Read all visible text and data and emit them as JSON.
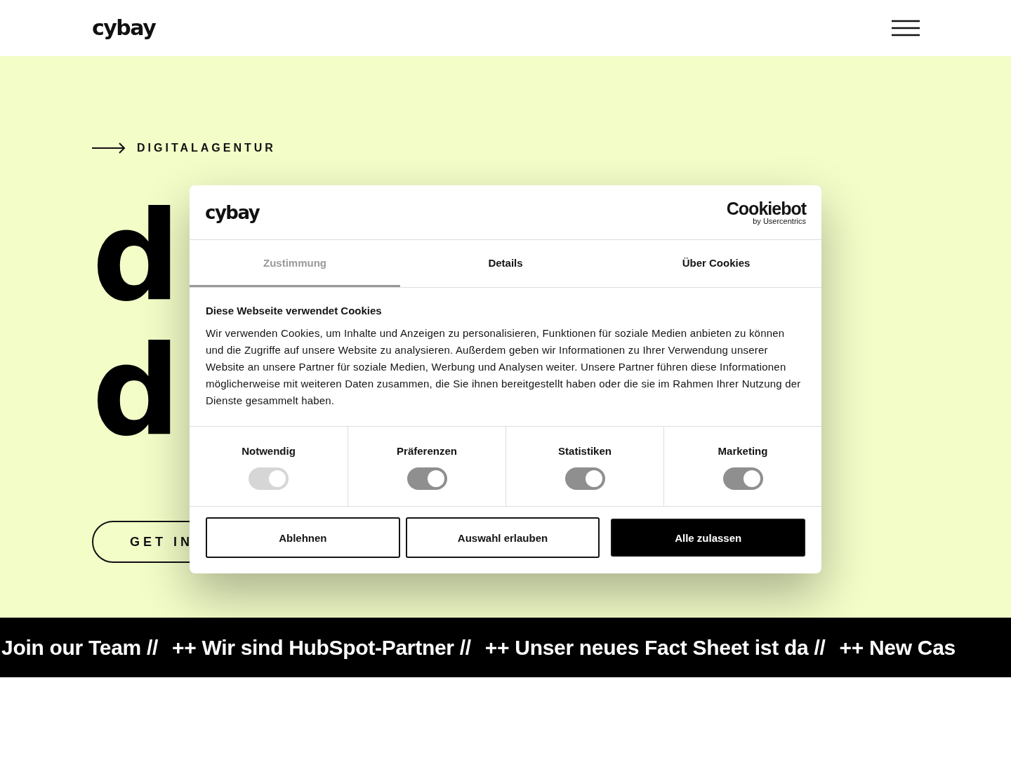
{
  "header": {
    "logo": "cybay"
  },
  "hero": {
    "eyebrow": "DIGITALAGENTUR",
    "headline_line_1_start": "d",
    "headline_line_2_start": "d",
    "cta": "GET IN"
  },
  "ticker": [
    "Join our Team //",
    "++ Wir sind HubSpot-Partner //",
    "++ Unser neues Fact Sheet ist da //",
    "++ New Cas"
  ],
  "cookie_dialog": {
    "logo": "cybay",
    "provider_logo": "Cookiebot",
    "provider_tagline": "by Usercentrics",
    "tabs": [
      {
        "label": "Zustimmung",
        "selected": true
      },
      {
        "label": "Details",
        "selected": false
      },
      {
        "label": "Über Cookies",
        "selected": false
      }
    ],
    "heading": "Diese Webseite verwendet Cookies",
    "body": "Wir verwenden Cookies, um Inhalte und Anzeigen zu personalisieren, Funktionen für soziale Medien anbieten zu können und die Zugriffe auf unsere Website zu analysieren. Außerdem geben wir Informationen zu Ihrer Verwendung unserer Website an unsere Partner für soziale Medien, Werbung und Analysen weiter. Unsere Partner führen diese Informationen möglicherweise mit weiteren Daten zusammen, die Sie ihnen bereitgestellt haben oder die sie im Rahmen Ihrer Nutzung der Dienste gesammelt haben.",
    "categories": [
      {
        "label": "Notwendig",
        "on": true,
        "disabled": true
      },
      {
        "label": "Präferenzen",
        "on": true,
        "disabled": false
      },
      {
        "label": "Statistiken",
        "on": true,
        "disabled": false
      },
      {
        "label": "Marketing",
        "on": true,
        "disabled": false
      }
    ],
    "buttons": [
      {
        "label": "Ablehnen",
        "kind": "outline"
      },
      {
        "label": "Auswahl erlauben",
        "kind": "outline"
      },
      {
        "label": "Alle zulassen",
        "kind": "primary"
      }
    ]
  }
}
